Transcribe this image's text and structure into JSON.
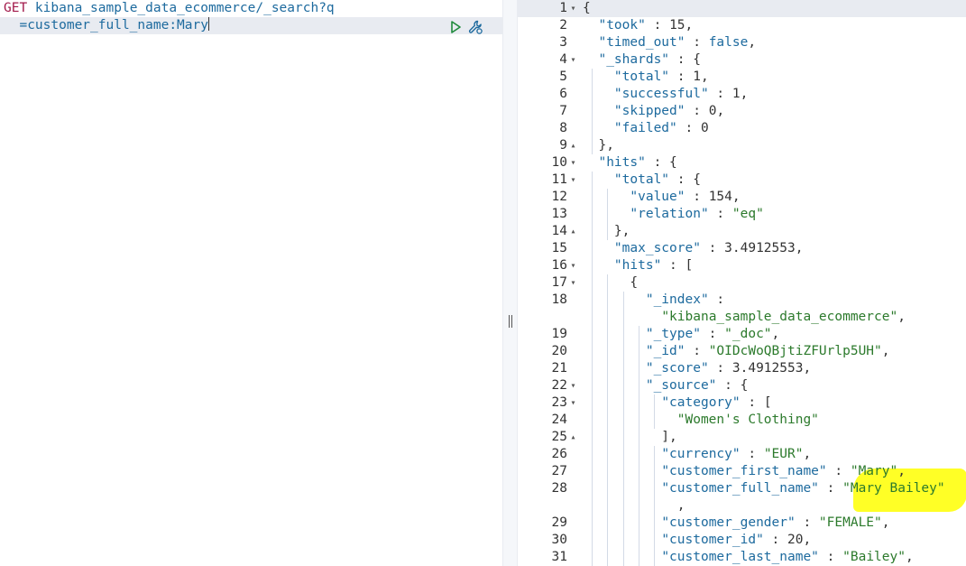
{
  "request": {
    "line1_method": "GET",
    "line1_path": " kibana_sample_data_ecommerce/_search?q",
    "line2": "  =customer_full_name:Mary",
    "run_icon": "play-icon",
    "settings_icon": "wrench-icon"
  },
  "response": {
    "lines": [
      {
        "n": "1",
        "f": "▾",
        "t": [
          [
            "p",
            "{"
          ]
        ]
      },
      {
        "n": "2",
        "f": "",
        "t": [
          [
            "p",
            "  "
          ],
          [
            "k",
            "\"took\""
          ],
          [
            "p",
            " : "
          ],
          [
            "n",
            "15"
          ],
          [
            "p",
            ","
          ]
        ]
      },
      {
        "n": "3",
        "f": "",
        "t": [
          [
            "p",
            "  "
          ],
          [
            "k",
            "\"timed_out\""
          ],
          [
            "p",
            " : "
          ],
          [
            "b",
            "false"
          ],
          [
            "p",
            ","
          ]
        ]
      },
      {
        "n": "4",
        "f": "▾",
        "t": [
          [
            "p",
            "  "
          ],
          [
            "k",
            "\"_shards\""
          ],
          [
            "p",
            " : {"
          ]
        ]
      },
      {
        "n": "5",
        "f": "",
        "t": [
          [
            "p",
            "    "
          ],
          [
            "k",
            "\"total\""
          ],
          [
            "p",
            " : "
          ],
          [
            "n",
            "1"
          ],
          [
            "p",
            ","
          ]
        ]
      },
      {
        "n": "6",
        "f": "",
        "t": [
          [
            "p",
            "    "
          ],
          [
            "k",
            "\"successful\""
          ],
          [
            "p",
            " : "
          ],
          [
            "n",
            "1"
          ],
          [
            "p",
            ","
          ]
        ]
      },
      {
        "n": "7",
        "f": "",
        "t": [
          [
            "p",
            "    "
          ],
          [
            "k",
            "\"skipped\""
          ],
          [
            "p",
            " : "
          ],
          [
            "n",
            "0"
          ],
          [
            "p",
            ","
          ]
        ]
      },
      {
        "n": "8",
        "f": "",
        "t": [
          [
            "p",
            "    "
          ],
          [
            "k",
            "\"failed\""
          ],
          [
            "p",
            " : "
          ],
          [
            "n",
            "0"
          ]
        ]
      },
      {
        "n": "9",
        "f": "▴",
        "t": [
          [
            "p",
            "  },"
          ]
        ]
      },
      {
        "n": "10",
        "f": "▾",
        "t": [
          [
            "p",
            "  "
          ],
          [
            "k",
            "\"hits\""
          ],
          [
            "p",
            " : {"
          ]
        ]
      },
      {
        "n": "11",
        "f": "▾",
        "t": [
          [
            "p",
            "    "
          ],
          [
            "k",
            "\"total\""
          ],
          [
            "p",
            " : {"
          ]
        ]
      },
      {
        "n": "12",
        "f": "",
        "t": [
          [
            "p",
            "      "
          ],
          [
            "k",
            "\"value\""
          ],
          [
            "p",
            " : "
          ],
          [
            "n",
            "154"
          ],
          [
            "p",
            ","
          ]
        ]
      },
      {
        "n": "13",
        "f": "",
        "t": [
          [
            "p",
            "      "
          ],
          [
            "k",
            "\"relation\""
          ],
          [
            "p",
            " : "
          ],
          [
            "s",
            "\"eq\""
          ]
        ]
      },
      {
        "n": "14",
        "f": "▴",
        "t": [
          [
            "p",
            "    },"
          ]
        ]
      },
      {
        "n": "15",
        "f": "",
        "t": [
          [
            "p",
            "    "
          ],
          [
            "k",
            "\"max_score\""
          ],
          [
            "p",
            " : "
          ],
          [
            "n",
            "3.4912553"
          ],
          [
            "p",
            ","
          ]
        ]
      },
      {
        "n": "16",
        "f": "▾",
        "t": [
          [
            "p",
            "    "
          ],
          [
            "k",
            "\"hits\""
          ],
          [
            "p",
            " : ["
          ]
        ]
      },
      {
        "n": "17",
        "f": "▾",
        "t": [
          [
            "p",
            "      {"
          ]
        ]
      },
      {
        "n": "18",
        "f": "",
        "t": [
          [
            "p",
            "        "
          ],
          [
            "k",
            "\"_index\""
          ],
          [
            "p",
            " :"
          ]
        ]
      },
      {
        "n": "",
        "f": "",
        "t": [
          [
            "p",
            "          "
          ],
          [
            "s",
            "\"kibana_sample_data_ecommerce\""
          ],
          [
            "p",
            ","
          ]
        ]
      },
      {
        "n": "19",
        "f": "",
        "t": [
          [
            "p",
            "        "
          ],
          [
            "k",
            "\"_type\""
          ],
          [
            "p",
            " : "
          ],
          [
            "s",
            "\"_doc\""
          ],
          [
            "p",
            ","
          ]
        ]
      },
      {
        "n": "20",
        "f": "",
        "t": [
          [
            "p",
            "        "
          ],
          [
            "k",
            "\"_id\""
          ],
          [
            "p",
            " : "
          ],
          [
            "s",
            "\"OIDcWoQBjtiZFUrlp5UH\""
          ],
          [
            "p",
            ","
          ]
        ]
      },
      {
        "n": "21",
        "f": "",
        "t": [
          [
            "p",
            "        "
          ],
          [
            "k",
            "\"_score\""
          ],
          [
            "p",
            " : "
          ],
          [
            "n",
            "3.4912553"
          ],
          [
            "p",
            ","
          ]
        ]
      },
      {
        "n": "22",
        "f": "▾",
        "t": [
          [
            "p",
            "        "
          ],
          [
            "k",
            "\"_source\""
          ],
          [
            "p",
            " : {"
          ]
        ]
      },
      {
        "n": "23",
        "f": "▾",
        "t": [
          [
            "p",
            "          "
          ],
          [
            "k",
            "\"category\""
          ],
          [
            "p",
            " : ["
          ]
        ]
      },
      {
        "n": "24",
        "f": "",
        "t": [
          [
            "p",
            "            "
          ],
          [
            "s",
            "\"Women's Clothing\""
          ]
        ]
      },
      {
        "n": "25",
        "f": "▴",
        "t": [
          [
            "p",
            "          ],"
          ]
        ]
      },
      {
        "n": "26",
        "f": "",
        "t": [
          [
            "p",
            "          "
          ],
          [
            "k",
            "\"currency\""
          ],
          [
            "p",
            " : "
          ],
          [
            "s",
            "\"EUR\""
          ],
          [
            "p",
            ","
          ]
        ]
      },
      {
        "n": "27",
        "f": "",
        "t": [
          [
            "p",
            "          "
          ],
          [
            "k",
            "\"customer_first_name\""
          ],
          [
            "p",
            " : "
          ],
          [
            "s",
            "\"Mary\""
          ],
          [
            "p",
            ","
          ]
        ]
      },
      {
        "n": "28",
        "f": "",
        "t": [
          [
            "p",
            "          "
          ],
          [
            "k",
            "\"customer_full_name\""
          ],
          [
            "p",
            " : "
          ],
          [
            "s",
            "\"Mary Bailey\""
          ]
        ]
      },
      {
        "n": "",
        "f": "",
        "t": [
          [
            "p",
            "            ,"
          ]
        ]
      },
      {
        "n": "29",
        "f": "",
        "t": [
          [
            "p",
            "          "
          ],
          [
            "k",
            "\"customer_gender\""
          ],
          [
            "p",
            " : "
          ],
          [
            "s",
            "\"FEMALE\""
          ],
          [
            "p",
            ","
          ]
        ]
      },
      {
        "n": "30",
        "f": "",
        "t": [
          [
            "p",
            "          "
          ],
          [
            "k",
            "\"customer_id\""
          ],
          [
            "p",
            " : "
          ],
          [
            "n",
            "20"
          ],
          [
            "p",
            ","
          ]
        ]
      },
      {
        "n": "31",
        "f": "",
        "t": [
          [
            "p",
            "          "
          ],
          [
            "k",
            "\"customer_last_name\""
          ],
          [
            "p",
            " : "
          ],
          [
            "s",
            "\"Bailey\""
          ],
          [
            "p",
            ","
          ]
        ]
      }
    ]
  },
  "colors": {
    "method": "#a21a4b",
    "key": "#1d6a9e",
    "string": "#2c7a2c",
    "highlight": "#ffff00",
    "active_line": "#e8ebf1"
  }
}
